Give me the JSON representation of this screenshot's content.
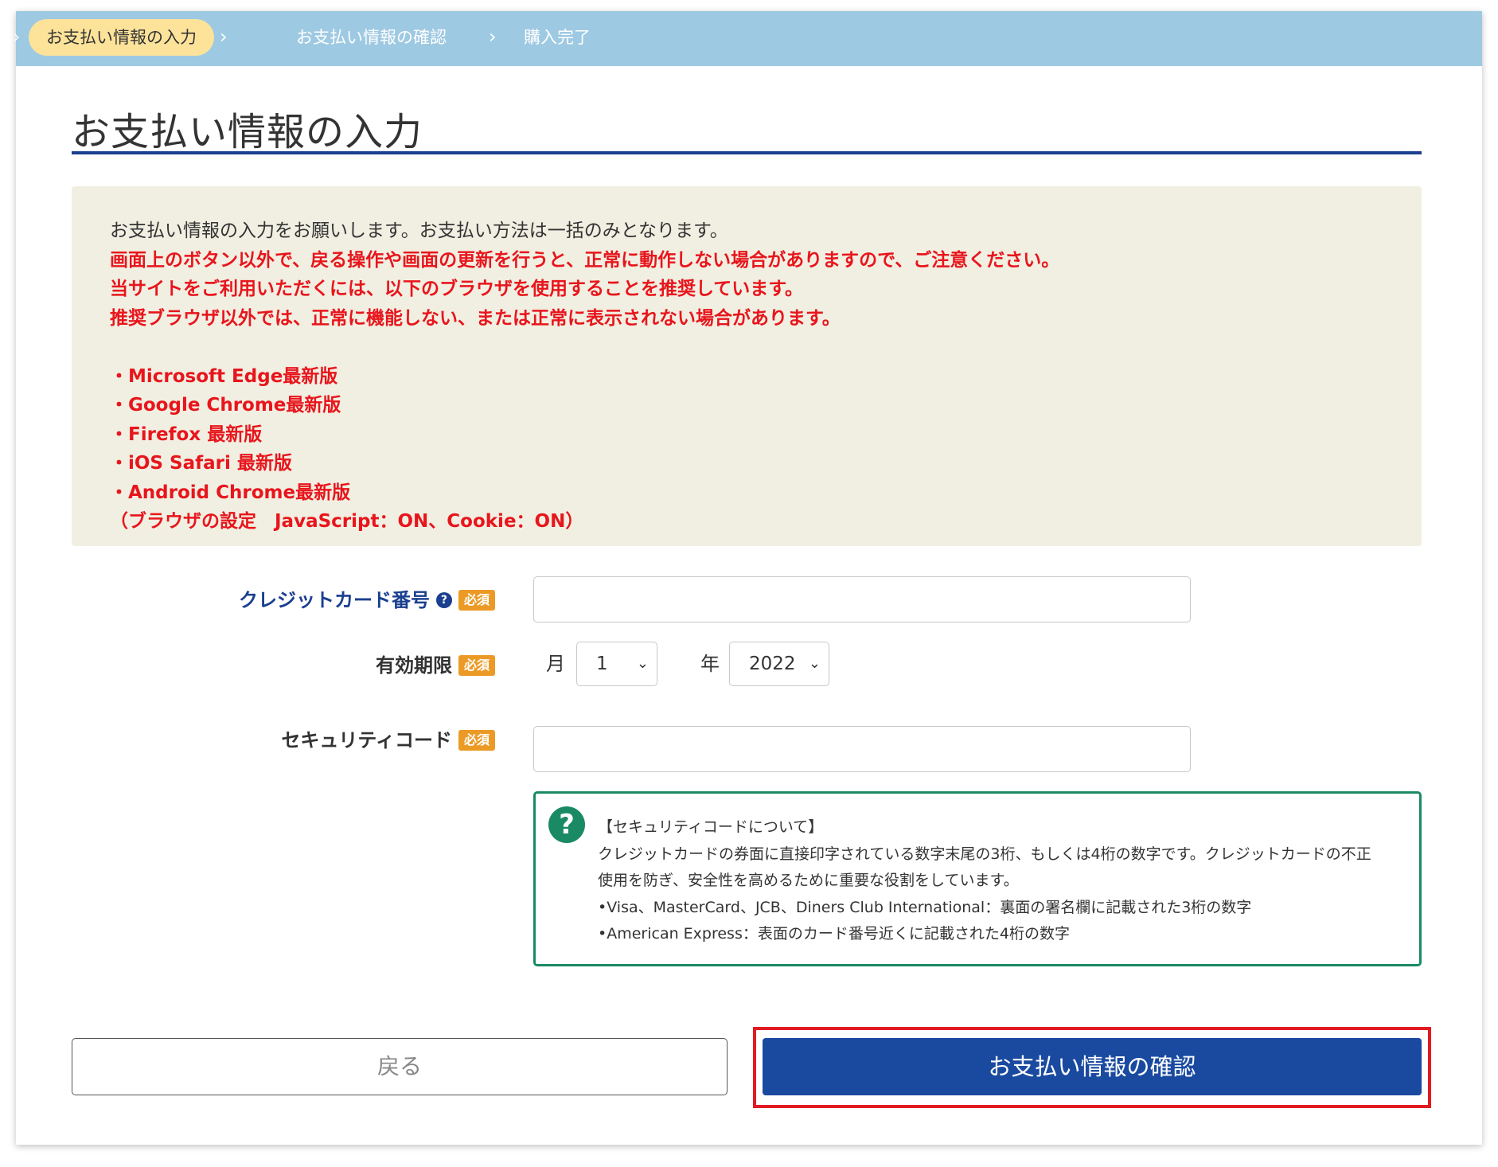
{
  "steps": [
    {
      "label": "お支払い情報の入力",
      "active": true
    },
    {
      "label": "お支払い情報の確認",
      "active": false
    },
    {
      "label": "購入完了",
      "active": false
    }
  ],
  "page_title": "お支払い情報の入力",
  "notice": {
    "intro": "お支払い情報の入力をお願いします。お支払い方法は一括のみとなります。",
    "warnings": [
      "画面上のボタン以外で、戻る操作や画面の更新を行うと、正常に動作しない場合がありますので、ご注意ください。",
      "当サイトをご利用いただくには、以下のブラウザを使用することを推奨しています。",
      "推奨ブラウザ以外では、正常に機能しない、または正常に表示されない場合があります。"
    ],
    "browsers": [
      "・Microsoft Edge最新版",
      "・Google Chrome最新版",
      "・Firefox 最新版",
      "・iOS Safari 最新版",
      "・Android Chrome最新版"
    ],
    "settings": "（ブラウザの設定　JavaScript：ON、Cookie：ON）"
  },
  "form": {
    "card_number_label": "クレジットカード番号",
    "card_number_value": "",
    "required_badge": "必須",
    "expiry_label": "有効期限",
    "month_label": "月",
    "month_value": "1",
    "year_label": "年",
    "year_value": "2022",
    "security_code_label": "セキュリティコード",
    "security_code_value": ""
  },
  "security_info": {
    "title": "【セキュリティコードについて】",
    "lines": [
      "クレジットカードの券面に直接印字されている数字末尾の3桁、もしくは4桁の数字です。クレジットカードの不正",
      "使用を防ぎ、安全性を高めるために重要な役割をしています。",
      "•Visa、MasterCard、JCB、Diners Club International：裏面の署名欄に記載された3桁の数字",
      "•American Express：表面のカード番号近くに記載された4桁の数字"
    ]
  },
  "buttons": {
    "back": "戻る",
    "confirm": "お支払い情報の確認"
  },
  "colors": {
    "header_band": "#9ec9e2",
    "active_step": "#fde39a",
    "primary": "#1a4aa0",
    "warning_text": "#e8151c",
    "required_badge": "#ec9a26",
    "info_border": "#1a8a64",
    "highlight_border": "#e21a22"
  },
  "icons": {
    "step_separator": "chevron-right-icon",
    "card_help": "question-circle-icon",
    "info": "question-circle-icon",
    "select_caret": "chevron-down-icon"
  }
}
